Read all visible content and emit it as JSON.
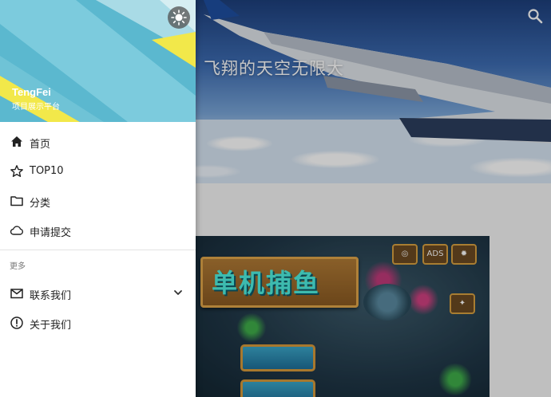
{
  "hero": {
    "title": "飞翔的天空无限大",
    "search_icon": "search-icon"
  },
  "drawer": {
    "profile": {
      "name": "TengFei",
      "subtitle": "项目展示平台"
    },
    "theme_icon": "sun-icon",
    "main_items": [
      {
        "label": "首页",
        "icon": "home-icon"
      },
      {
        "label": "TOP10",
        "icon": "star-outline-icon"
      },
      {
        "label": "分类",
        "icon": "folder-icon"
      },
      {
        "label": "申请提交",
        "icon": "cloud-icon"
      }
    ],
    "section_label": "更多",
    "more_items": [
      {
        "label": "联系我们",
        "icon": "mail-icon",
        "expand_icon": "chevron-down-icon"
      },
      {
        "label": "关于我们",
        "icon": "info-circle-icon"
      }
    ]
  },
  "game": {
    "title": "单机捕鱼",
    "ads_label": "ADS"
  },
  "colors": {
    "drawer_bg": "#ffffff",
    "header_teal": "#5bb8cf",
    "header_yellow": "#f2e84a",
    "text_primary": "#222222",
    "text_secondary": "#777777"
  }
}
